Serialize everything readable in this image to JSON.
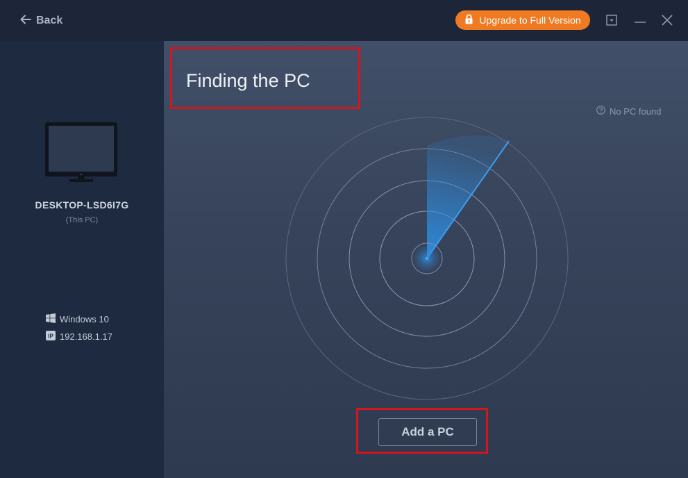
{
  "header": {
    "back_label": "Back",
    "upgrade_label": "Upgrade to Full Version"
  },
  "sidebar": {
    "pc_name": "DESKTOP-LSD6I7G",
    "pc_subtitle": "(This PC)",
    "os": "Windows 10",
    "ip": "192.168.1.17"
  },
  "main": {
    "title": "Finding the PC",
    "status": "No PC found",
    "add_button": "Add a PC"
  },
  "colors": {
    "accent": "#f07a22",
    "highlight_border": "#d5141c",
    "radar_sweep": "#2f8de0"
  },
  "icons": {
    "back": "arrow-left-icon",
    "upgrade": "lock-icon",
    "dropdown": "dropdown-box-icon",
    "minimize": "minimize-icon",
    "close": "close-icon",
    "monitor": "monitor-icon",
    "os": "windows-logo-icon",
    "ip": "ip-badge-icon",
    "status": "question-circle-icon"
  }
}
